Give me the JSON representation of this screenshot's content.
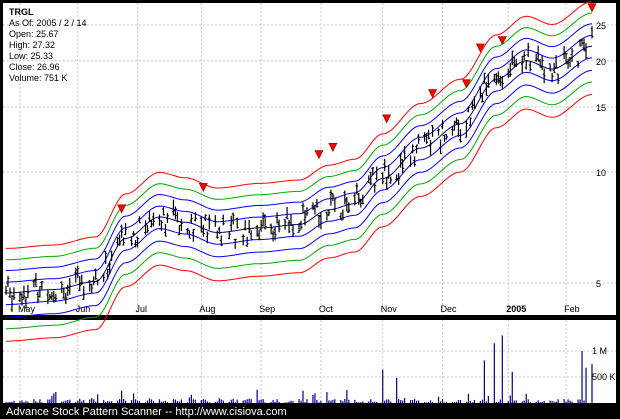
{
  "info": {
    "symbol": "TRGL",
    "as_of": "As Of: 2005 / 2 / 14",
    "open": "Open: 25.67",
    "high": "High: 27.32",
    "low": "Low: 25.33",
    "close": "Close: 26.96",
    "volume": "Volume: 751 K"
  },
  "footer": "Advance Stock Pattern Scanner -- http://www.cisiova.com",
  "colors": {
    "background": "#000000",
    "panel": "#ffffff",
    "price_bar": "#000000",
    "band_outer": "#ff0000",
    "band_mid": "#00aa00",
    "band_inner": "#0000ff",
    "band_center": "#000080",
    "marker": "#ff0000",
    "volume": "#00008b"
  },
  "chart_data": {
    "type": "ohlc",
    "y_scale": "log",
    "price_ticks": [
      5,
      10,
      15,
      20,
      25
    ],
    "volume_ticks": [
      "500 K",
      "1 M"
    ],
    "x_labels": [
      "May",
      "Jun",
      "Jul",
      "Aug",
      "Sep",
      "Oct",
      "Nov",
      "Dec",
      "2005",
      "Feb"
    ],
    "bands": {
      "center_control_points": [
        [
          "2004-04-26",
          4.7
        ],
        [
          "2004-05-20",
          4.8
        ],
        [
          "2004-06-10",
          5.05
        ],
        [
          "2004-06-25",
          6.6
        ],
        [
          "2004-07-12",
          7.55
        ],
        [
          "2004-07-25",
          7.3
        ],
        [
          "2004-08-10",
          6.85
        ],
        [
          "2004-08-31",
          7.05
        ],
        [
          "2004-09-20",
          7.2
        ],
        [
          "2004-10-05",
          7.9
        ],
        [
          "2004-10-18",
          8.2
        ],
        [
          "2004-11-01",
          9.6
        ],
        [
          "2004-11-20",
          11.6
        ],
        [
          "2004-12-10",
          13.5
        ],
        [
          "2004-12-28",
          17.8
        ],
        [
          "2005-01-12",
          20.0
        ],
        [
          "2005-01-25",
          19.0
        ],
        [
          "2005-02-14",
          21.9
        ]
      ],
      "multipliers": [
        0.74,
        0.8,
        0.86,
        0.93,
        1.0,
        1.07,
        1.15,
        1.23,
        1.32
      ]
    },
    "markers": [
      [
        "2004-06-23",
        7.7
      ],
      [
        "2004-08-03",
        8.8
      ],
      [
        "2004-09-30",
        10.8
      ],
      [
        "2004-10-07",
        11.3
      ],
      [
        "2004-11-03",
        13.5
      ],
      [
        "2004-11-26",
        15.8
      ],
      [
        "2004-12-13",
        16.8
      ],
      [
        "2004-12-20",
        21.0
      ],
      [
        "2004-12-31",
        22.0
      ],
      [
        "2005-02-14",
        27.0
      ]
    ],
    "volume_peaks": [
      [
        "2004-11-01",
        640
      ],
      [
        "2004-11-08",
        480
      ],
      [
        "2004-12-22",
        820
      ],
      [
        "2004-12-27",
        1150
      ],
      [
        "2004-12-31",
        1300
      ],
      [
        "2005-01-05",
        600
      ],
      [
        "2005-02-09",
        1000
      ],
      [
        "2005-02-11",
        680
      ],
      [
        "2005-02-14",
        751
      ]
    ],
    "date_range": [
      "2004-04-26",
      "2005-02-14"
    ]
  }
}
